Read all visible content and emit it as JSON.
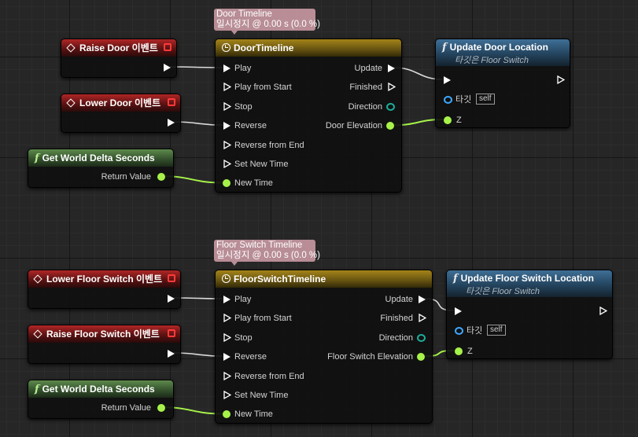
{
  "timelines": [
    {
      "comment_title": "Door Timeline",
      "comment_status": "일시정지 @ 0.00 s (0.0 %)",
      "timeline_title": "DoorTimeline",
      "events": [
        {
          "label": "Raise Door 이벤트"
        },
        {
          "label": "Lower Door 이벤트"
        }
      ],
      "delta": {
        "title": "Get World Delta Seconds",
        "output": "Return Value"
      },
      "inputs": [
        "Play",
        "Play from Start",
        "Stop",
        "Reverse",
        "Reverse from End",
        "Set New Time",
        "New Time"
      ],
      "outputs": [
        "Update",
        "Finished",
        "Direction",
        "Door Elevation"
      ],
      "func": {
        "title": "Update Door Location",
        "subtitle": "타깃은 Floor Switch",
        "target_label": "타깃",
        "target_value": "self",
        "param": "Z"
      }
    },
    {
      "comment_title": "Floor Switch Timeline",
      "comment_status": "일시정지 @ 0.00 s (0.0 %)",
      "timeline_title": "FloorSwitchTimeline",
      "events": [
        {
          "label": "Lower Floor Switch 이벤트"
        },
        {
          "label": "Raise Floor Switch 이벤트"
        }
      ],
      "delta": {
        "title": "Get World Delta Seconds",
        "output": "Return Value"
      },
      "inputs": [
        "Play",
        "Play from Start",
        "Stop",
        "Reverse",
        "Reverse from End",
        "Set New Time",
        "New Time"
      ],
      "outputs": [
        "Update",
        "Finished",
        "Direction",
        "Floor Switch Elevation"
      ],
      "func": {
        "title": "Update Floor Switch Location",
        "subtitle": "타깃은 Floor Switch",
        "target_label": "타깃",
        "target_value": "self",
        "param": "Z"
      }
    }
  ],
  "colors": {
    "exec_wire": "#dcdcdc",
    "float_wire": "#a7f24a",
    "event_header": "#b02626",
    "pure_header": "#5d8a4c",
    "timeline_header": "#a48418",
    "function_header": "#3f6f96",
    "event_square": "#ff3a3a",
    "object_pin": "#3fa7ff",
    "struct_pin": "#1cae9a",
    "comment_bubble": "#d2a0aa"
  },
  "icons": {
    "event": "event-diamond-icon",
    "function": "function-f-icon",
    "timeline": "timeline-clock-icon"
  }
}
